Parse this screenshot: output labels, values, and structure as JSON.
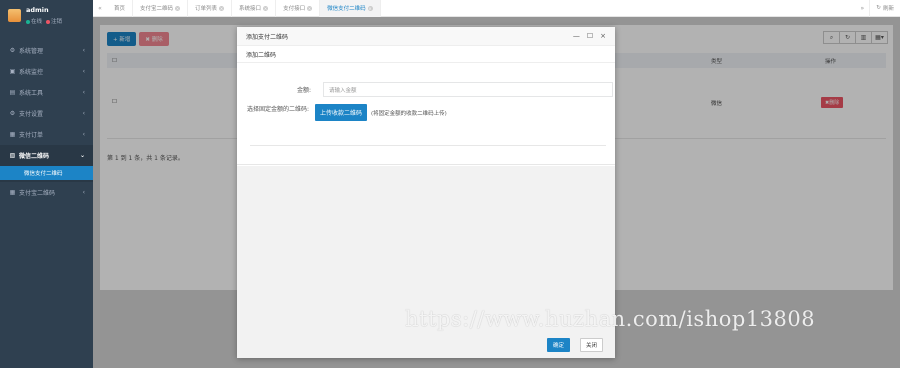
{
  "sidebar": {
    "profile": {
      "name": "admin",
      "status_online": "在线",
      "status_logout": "注销"
    },
    "items": [
      {
        "label": "系统管理",
        "glyph": "⚙"
      },
      {
        "label": "系统监控",
        "glyph": "▣"
      },
      {
        "label": "系统工具",
        "glyph": "▤"
      },
      {
        "label": "支付设置",
        "glyph": "⚙"
      },
      {
        "label": "支付订单",
        "glyph": "▦"
      },
      {
        "label": "微信二维码",
        "glyph": "▧",
        "active": true
      },
      {
        "label": "支付宝二维码",
        "glyph": "▦"
      }
    ],
    "submenu": {
      "label": "微信支付二维码"
    }
  },
  "topbar": {
    "tabs": [
      {
        "label": "首页"
      },
      {
        "label": "支付宝二维码"
      },
      {
        "label": "订单列表"
      },
      {
        "label": "系统接口"
      },
      {
        "label": "支付接口"
      },
      {
        "label": "微信支付二维码",
        "active": true
      }
    ],
    "refresh_label": "刷新"
  },
  "content": {
    "add_label": "新增",
    "delete_label": "删除",
    "table": {
      "col_type": "类型",
      "col_op": "操作",
      "row_type": "微信",
      "row_delete": "删除"
    },
    "footer": "第 1 到 1 条，共 1 条记录。"
  },
  "modal": {
    "title": "添加支付二维码",
    "inner_title": "添加二维码",
    "amount_label": "金额:",
    "amount_placeholder": "请输入金额",
    "qr_label": "选择固定金额的二维码:",
    "upload_label": "上传收款二维码",
    "hint": "(将固定金额的收款二维码上传)",
    "ok_label": "确定",
    "close_label": "关闭"
  },
  "watermark": "https://www.huzhan.com/ishop13808"
}
